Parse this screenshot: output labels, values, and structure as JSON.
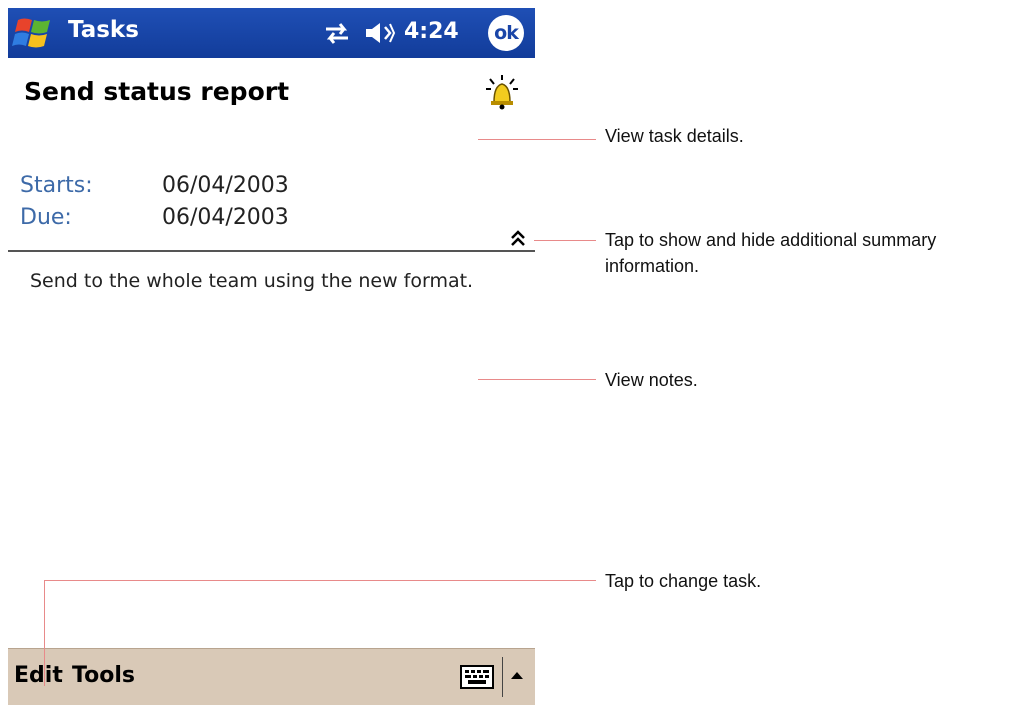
{
  "titlebar": {
    "app_title": "Tasks",
    "clock": "4:24",
    "ok_label": "ok",
    "icons": [
      "windows-start-icon",
      "connectivity-icon",
      "volume-icon"
    ]
  },
  "task": {
    "title": "Send status report",
    "reminder_icon": "bell-icon",
    "starts_label": "Starts:",
    "starts_value": "06/04/2003",
    "due_label": "Due:",
    "due_value": "06/04/2003",
    "notes": "Send to the whole team using the new format."
  },
  "menubar": {
    "edit_label": "Edit",
    "tools_label": "Tools",
    "icons": [
      "keyboard-icon",
      "up-arrow-icon"
    ]
  },
  "callouts": {
    "details": "View task details.",
    "toggle_summary": "Tap to show and hide additional summary information.",
    "notes": "View notes.",
    "change_task": "Tap to change task."
  },
  "colors": {
    "titlebar_blue": "#1a45a8",
    "menubar_beige": "#d9c9b7",
    "label_blue": "#3d6aa8",
    "callout_line": "#e88a8a"
  }
}
